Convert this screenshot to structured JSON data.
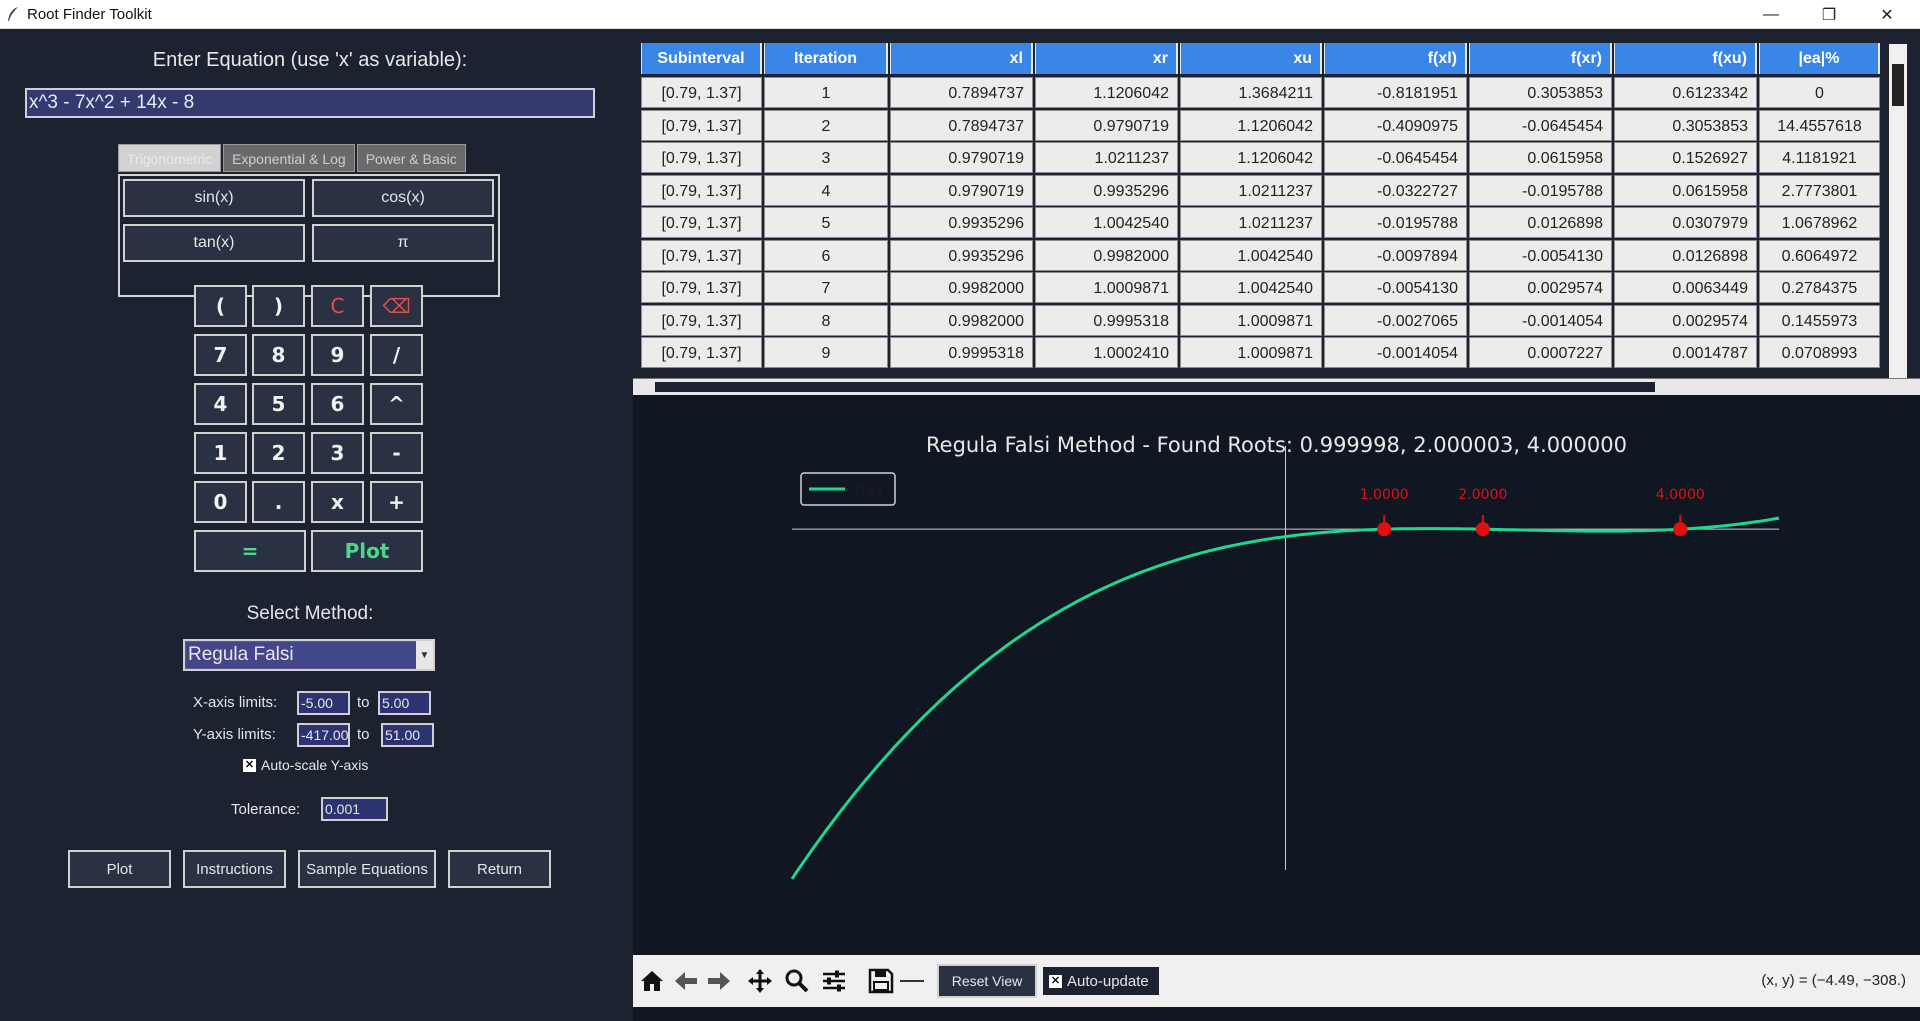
{
  "window": {
    "title": "Root Finder Toolkit",
    "minimize_glyph": "—",
    "restore_glyph": "❐",
    "close_glyph": "✕"
  },
  "equation": {
    "label": "Enter Equation (use 'x' as variable):",
    "value": "x^3 - 7x^2 + 14x - 8"
  },
  "function_tabs": [
    {
      "label": "Trigonometric",
      "active": true
    },
    {
      "label": "Exponential & Log",
      "active": false
    },
    {
      "label": "Power & Basic",
      "active": false
    }
  ],
  "function_buttons": [
    "sin(x)",
    "cos(x)",
    "tan(x)",
    "π"
  ],
  "keypad": [
    [
      "(",
      ")",
      "C",
      "⌫"
    ],
    [
      "7",
      "8",
      "9",
      "/"
    ],
    [
      "4",
      "5",
      "6",
      "^"
    ],
    [
      "1",
      "2",
      "3",
      "-"
    ],
    [
      "0",
      ".",
      "x",
      "+"
    ]
  ],
  "keypad_bottom": {
    "equals": "=",
    "plot": "Plot"
  },
  "method": {
    "label": "Select Method:",
    "value": "Regula Falsi"
  },
  "limits": {
    "x_label": "X-axis limits:",
    "x_min": "-5.00",
    "x_max": "5.00",
    "y_label": "Y-axis limits:",
    "y_min": "-417.00",
    "y_max": "51.00",
    "to": "to",
    "autoscale_label": "Auto-scale Y-axis",
    "autoscale_checked": true
  },
  "tolerance": {
    "label": "Tolerance:",
    "value": "0.001"
  },
  "bottom_buttons": [
    "Plot",
    "Instructions",
    "Sample Equations",
    "Return"
  ],
  "table": {
    "columns": [
      "Subinterval",
      "Iteration",
      "xl",
      "xr",
      "xu",
      "f(xl)",
      "f(xr)",
      "f(xu)",
      "|ea|%"
    ],
    "rows": [
      [
        "[0.79, 1.37]",
        "1",
        "0.7894737",
        "1.1206042",
        "1.3684211",
        "-0.8181951",
        "0.3053853",
        "0.6123342",
        "0"
      ],
      [
        "[0.79, 1.37]",
        "2",
        "0.7894737",
        "0.9790719",
        "1.1206042",
        "-0.4090975",
        "-0.0645454",
        "0.3053853",
        "14.4557618"
      ],
      [
        "[0.79, 1.37]",
        "3",
        "0.9790719",
        "1.0211237",
        "1.1206042",
        "-0.0645454",
        "0.0615958",
        "0.1526927",
        "4.1181921"
      ],
      [
        "[0.79, 1.37]",
        "4",
        "0.9790719",
        "0.9935296",
        "1.0211237",
        "-0.0322727",
        "-0.0195788",
        "0.0615958",
        "2.7773801"
      ],
      [
        "[0.79, 1.37]",
        "5",
        "0.9935296",
        "1.0042540",
        "1.0211237",
        "-0.0195788",
        "0.0126898",
        "0.0307979",
        "1.0678962"
      ],
      [
        "[0.79, 1.37]",
        "6",
        "0.9935296",
        "0.9982000",
        "1.0042540",
        "-0.0097894",
        "-0.0054130",
        "0.0126898",
        "0.6064972"
      ],
      [
        "[0.79, 1.37]",
        "7",
        "0.9982000",
        "1.0009871",
        "1.0042540",
        "-0.0054130",
        "0.0029574",
        "0.0063449",
        "0.2784375"
      ],
      [
        "[0.79, 1.37]",
        "8",
        "0.9982000",
        "0.9995318",
        "1.0009871",
        "-0.0027065",
        "-0.0014054",
        "0.0029574",
        "0.1455973"
      ],
      [
        "[0.79, 1.37]",
        "9",
        "0.9995318",
        "1.0002410",
        "1.0009871",
        "-0.0014054",
        "0.0007227",
        "0.0014787",
        "0.0708993"
      ]
    ]
  },
  "chart_data": {
    "type": "line",
    "title": "Regula Falsi Method - Found Roots: 0.999998, 2.000003, 4.000000",
    "series": [
      {
        "name": "f(x)",
        "expression": "x^3 - 7x^2 + 14x - 8",
        "color": "#1fd890"
      }
    ],
    "xlim": [
      -5.0,
      5.0
    ],
    "ylim": [
      -417.0,
      51.0
    ],
    "roots": [
      {
        "x": 1.0,
        "label": "1.0000"
      },
      {
        "x": 2.0,
        "label": "2.0000"
      },
      {
        "x": 4.0,
        "label": "4.0000"
      }
    ],
    "root_color": "#e01010",
    "legend": "top-left",
    "grid": false,
    "axes_color": "#cccccc"
  },
  "toolbar": {
    "reset_label": "Reset View",
    "autoupdate_label": "Auto-update",
    "autoupdate_checked": true,
    "coords": "(x, y) = (−4.49, −308.)"
  }
}
